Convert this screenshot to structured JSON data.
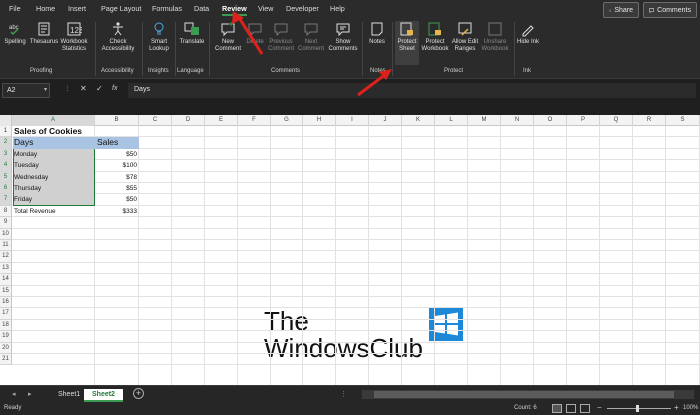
{
  "menu": {
    "tabs": [
      "File",
      "Home",
      "Insert",
      "Page Layout",
      "Formulas",
      "Data",
      "Review",
      "View",
      "Developer",
      "Help"
    ],
    "active": "Review",
    "share": "Share",
    "comments": "Comments"
  },
  "ribbon": {
    "buttons": {
      "spelling": "Spelling",
      "thesaurus": "Thesaurus",
      "workbook_statistics": "Workbook Statistics",
      "check_accessibility": "Check Accessibility",
      "smart_lookup": "Smart Lookup",
      "translate": "Translate",
      "new_comment": "New Comment",
      "delete": "Delete",
      "previous_comment": "Previous Comment",
      "next_comment": "Next Comment",
      "show_comments": "Show Comments",
      "notes": "Notes",
      "protect_sheet": "Protect Sheet",
      "protect_workbook": "Protect Workbook",
      "allow_edit_ranges": "Allow Edit Ranges",
      "unshare_workbook": "Unshare Workbook",
      "hide_ink": "Hide Ink"
    },
    "groups": {
      "proofing": "Proofing",
      "accessibility": "Accessibility",
      "insights": "Insights",
      "language": "Language",
      "comments": "Comments",
      "notes": "Notes",
      "protect": "Protect",
      "ink": "Ink"
    }
  },
  "formula_bar": {
    "name_box": "A2",
    "fx": "fx",
    "value": "Days"
  },
  "columns": [
    "A",
    "B",
    "C",
    "D",
    "E",
    "F",
    "G",
    "H",
    "I",
    "J",
    "K",
    "L",
    "M",
    "N",
    "O",
    "P",
    "Q",
    "R",
    "S"
  ],
  "rows": [
    "1",
    "2",
    "3",
    "4",
    "5",
    "6",
    "7",
    "8",
    "9",
    "10",
    "11",
    "12",
    "13",
    "14",
    "15",
    "16",
    "17",
    "18",
    "19",
    "20",
    "21"
  ],
  "sheet": {
    "title": "Sales of Cookies",
    "headers": {
      "days": "Days",
      "sales": "Sales"
    },
    "data": [
      {
        "day": "Monday",
        "sales": "$50"
      },
      {
        "day": "Tuesday",
        "sales": "$100"
      },
      {
        "day": "Wednesday",
        "sales": "$78"
      },
      {
        "day": "Thursday",
        "sales": "$55"
      },
      {
        "day": "Friday",
        "sales": "$50"
      }
    ],
    "total_label": "Total Revenue",
    "total_value": "$333"
  },
  "sheet_tabs": [
    "Sheet1",
    "Sheet2"
  ],
  "active_sheet": "Sheet2",
  "status": {
    "ready": "Ready",
    "count": "Count: 6",
    "zoom": "100%"
  },
  "watermark": {
    "line1": "The",
    "line2": "WindowsClub"
  },
  "colors": {
    "accent": "#3c9b52",
    "header_fill": "#a9c4e3",
    "selection": "#d0d0d0",
    "arrow": "#e0201b"
  }
}
